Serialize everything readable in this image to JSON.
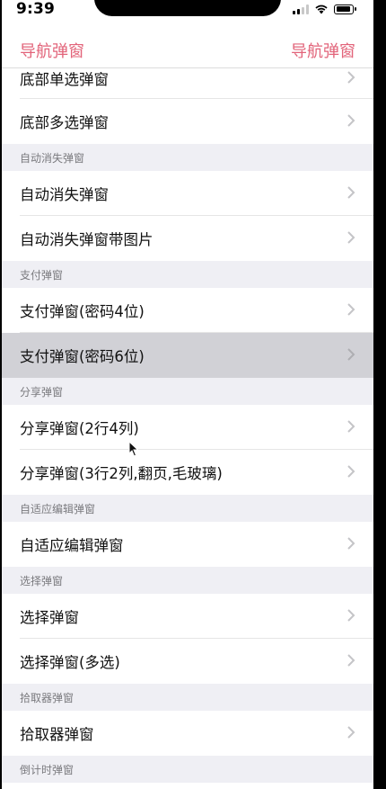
{
  "status_bar": {
    "time": "9:39"
  },
  "nav": {
    "left_label": "导航弹窗",
    "right_label": "导航弹窗"
  },
  "rows_top": [
    {
      "label": "底部单选弹窗"
    },
    {
      "label": "底部多选弹窗"
    }
  ],
  "sections": [
    {
      "header": "自动消失弹窗",
      "items": [
        {
          "label": "自动消失弹窗"
        },
        {
          "label": "自动消失弹窗带图片"
        }
      ]
    },
    {
      "header": "支付弹窗",
      "items": [
        {
          "label": "支付弹窗(密码4位)"
        },
        {
          "label": "支付弹窗(密码6位)"
        }
      ]
    },
    {
      "header": "分享弹窗",
      "items": [
        {
          "label": "分享弹窗(2行4列)"
        },
        {
          "label": "分享弹窗(3行2列,翻页,毛玻璃)"
        }
      ]
    },
    {
      "header": "自适应编辑弹窗",
      "items": [
        {
          "label": "自适应编辑弹窗"
        }
      ]
    },
    {
      "header": "选择弹窗",
      "items": [
        {
          "label": "选择弹窗"
        },
        {
          "label": "选择弹窗(多选)"
        }
      ]
    },
    {
      "header": "拾取器弹窗",
      "items": [
        {
          "label": "拾取器弹窗"
        }
      ]
    },
    {
      "header": "倒计时弹窗",
      "items": []
    }
  ],
  "colors": {
    "accent": "#e2647a",
    "section_bg": "#efeff4",
    "highlight_bg": "#d1d1d6"
  },
  "icons": {
    "chevron": "chevron-right-icon",
    "wifi": "wifi-icon",
    "battery": "battery-icon",
    "signal": "signal-icon"
  }
}
